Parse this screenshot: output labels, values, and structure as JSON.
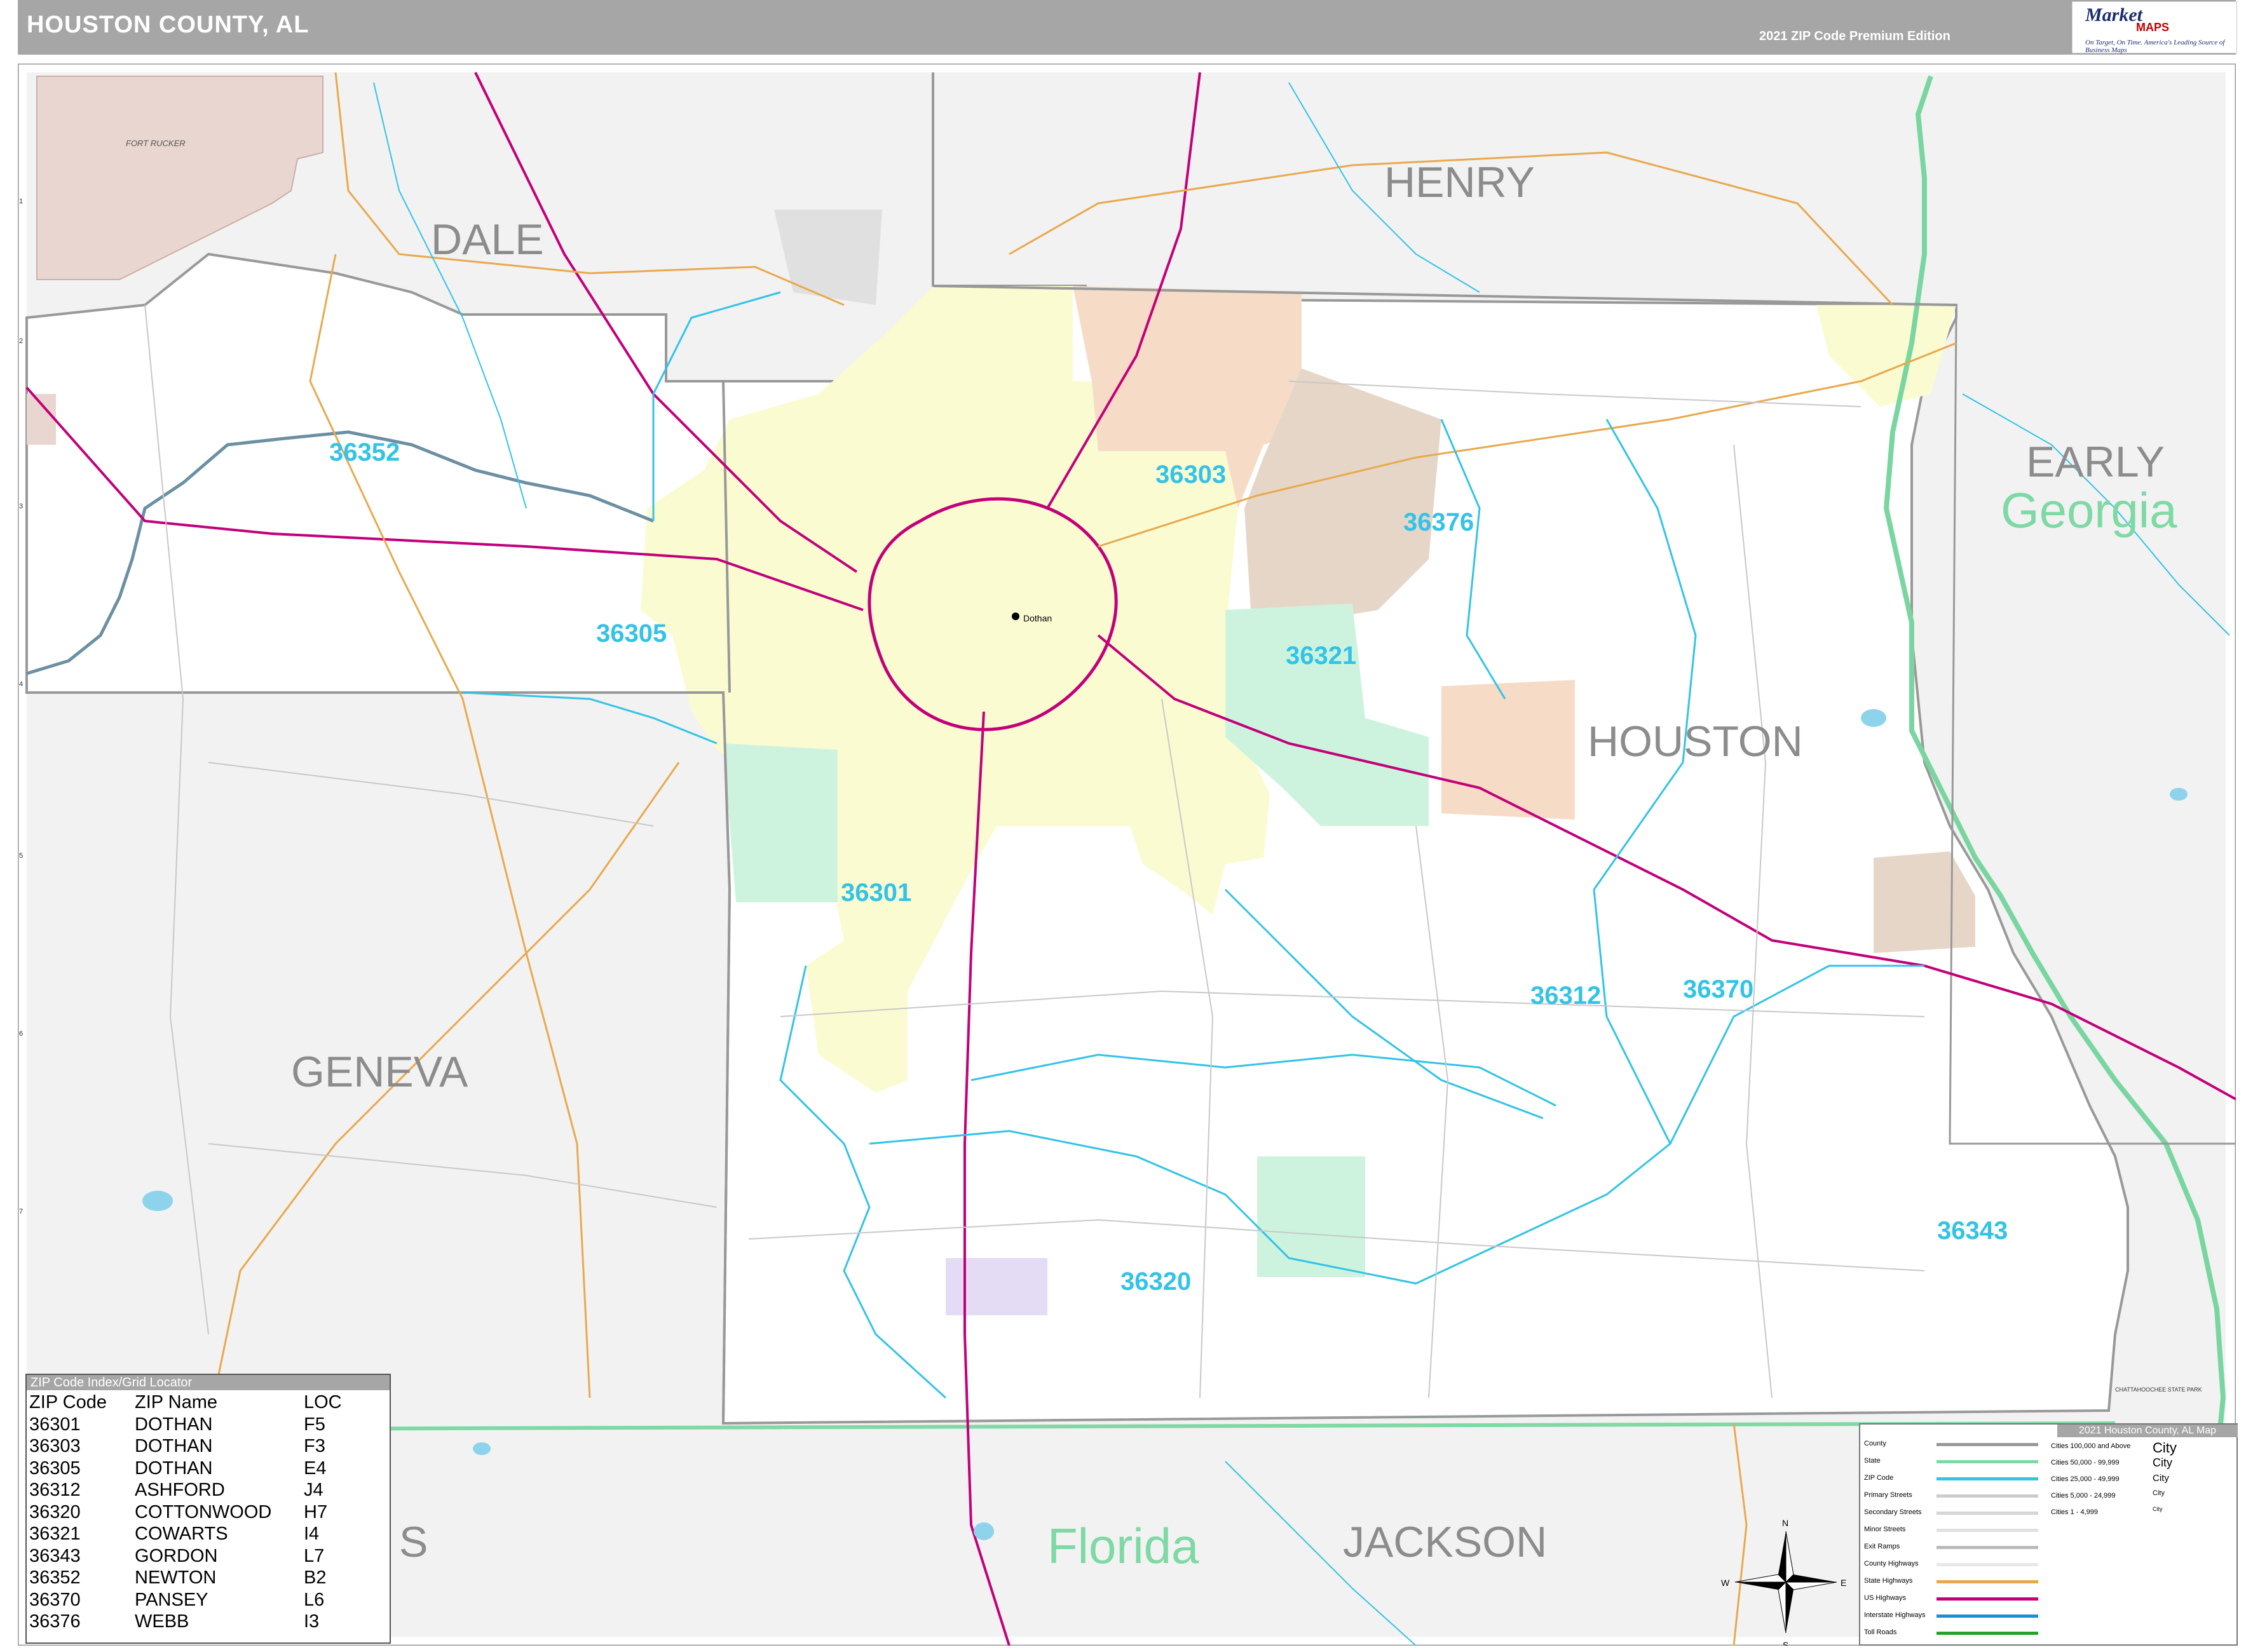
{
  "header": {
    "title": "HOUSTON COUNTY, AL",
    "edition": "2021 ZIP Code Premium Edition"
  },
  "logo": {
    "brand": "Market",
    "brand2": "MAPS",
    "tagline": "On Target, On Time. America's Leading Source of Business Maps"
  },
  "colors": {
    "header_bg": "#a6a6a6",
    "zip_label": "#33c3e6",
    "county_label": "#8c8c8c",
    "state_label": "#7ed9a4",
    "interstate": "#c2007a",
    "state_line": "#7ed9a4",
    "zip_boundary": "#33c3e6",
    "outside_county": "#f2f2f2"
  },
  "labels": {
    "counties": [
      "DALE",
      "HENRY",
      "EARLY",
      "HOUSTON",
      "GENEVA",
      "JACKSON",
      "S"
    ],
    "states": [
      "Georgia",
      "Florida"
    ],
    "zips": [
      "36352",
      "36303",
      "36376",
      "36305",
      "36321",
      "36301",
      "36312",
      "36370",
      "36343",
      "36320"
    ],
    "places": [
      "Dothan",
      "FORT RUCKER",
      "CHATTAHOOCHEE STATE PARK"
    ]
  },
  "zip_index": {
    "title": "ZIP Code Index/Grid Locator",
    "headers": [
      "ZIP Code",
      "ZIP Name",
      "LOC"
    ],
    "rows": [
      [
        "36301",
        "DOTHAN",
        "F5"
      ],
      [
        "36303",
        "DOTHAN",
        "F3"
      ],
      [
        "36305",
        "DOTHAN",
        "E4"
      ],
      [
        "36312",
        "ASHFORD",
        "J4"
      ],
      [
        "36320",
        "COTTONWOOD",
        "H7"
      ],
      [
        "36321",
        "COWARTS",
        "I4"
      ],
      [
        "36343",
        "GORDON",
        "L7"
      ],
      [
        "36352",
        "NEWTON",
        "B2"
      ],
      [
        "36370",
        "PANSEY",
        "L6"
      ],
      [
        "36376",
        "WEBB",
        "I3"
      ]
    ]
  },
  "legend": {
    "title": "2021 Houston County, AL Map",
    "items": [
      "County",
      "State",
      "ZIP Code",
      "Primary Streets",
      "Secondary Streets",
      "Minor Streets",
      "Exit Ramps",
      "County Highways",
      "State Highways",
      "US Highways",
      "Interstate Highways",
      "Toll Roads"
    ],
    "city_sizes": [
      "Cities 100,000 and Above",
      "Cities 50,000 - 99,999",
      "Cities 25,000 - 49,999",
      "Cities 5,000 - 24,999",
      "Cities 1 - 4,999"
    ],
    "city_samples": [
      "City",
      "City",
      "City",
      "City",
      "City"
    ]
  },
  "compass": {
    "n": "N",
    "s": "S",
    "e": "E",
    "w": "W"
  }
}
